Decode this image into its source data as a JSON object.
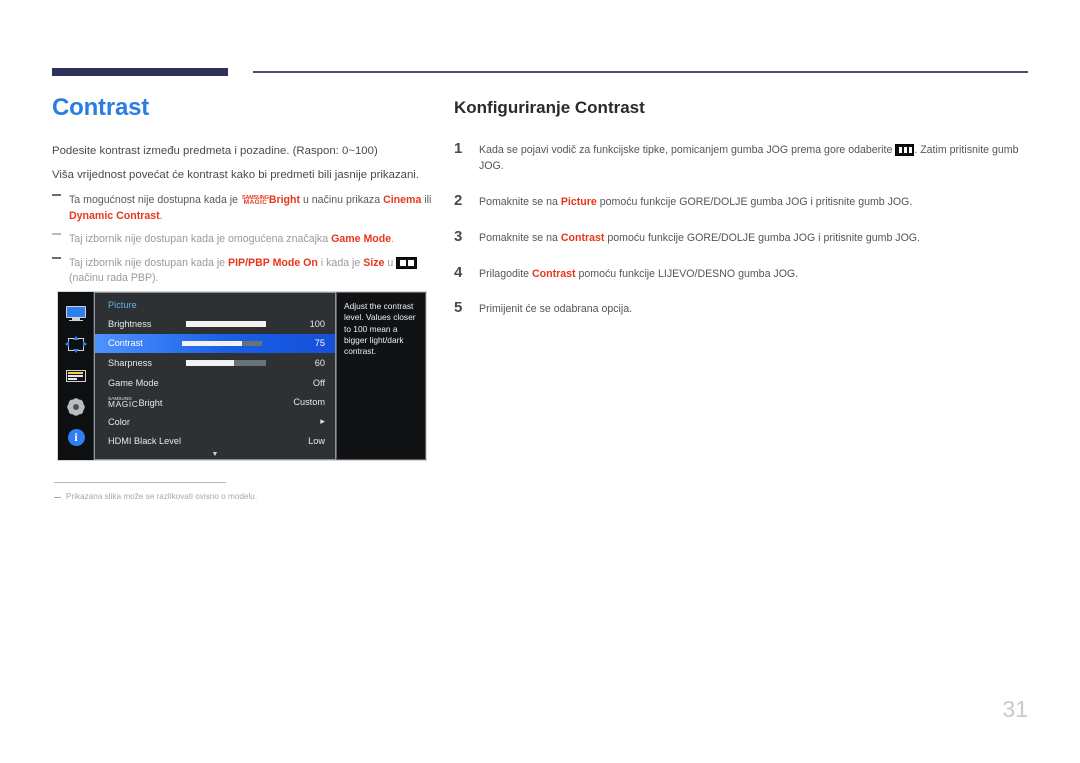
{
  "page": {
    "number": "31"
  },
  "left": {
    "title": "Contrast",
    "paragraphs": [
      "Podesite kontrast između predmeta i pozadine. (Raspon: 0~100)",
      "Viša vrijednost povećat će kontrast kako bi predmeti bili jasnije prikazani."
    ],
    "notes": [
      {
        "pre": "Ta mogućnost nije dostupna kada je ",
        "magic_top": "SAMSUNG",
        "magic_bottom": "MAGIC",
        "bold1": "Bright",
        "mid": " u načinu prikaza ",
        "bold2": "Cinema",
        "mid2": " ili ",
        "bold3": "Dynamic Contrast",
        "post": "."
      },
      {
        "pre": "Taj izbornik nije dostupan kada je omogućena značajka ",
        "bold1": "Game Mode",
        "post": "."
      },
      {
        "pre": "Taj izbornik nije dostupan kada je ",
        "bold1": "PIP/PBP Mode On",
        "mid": " i kada je ",
        "bold2": "Size",
        "mid2": " u ",
        "icon": "split-screen-icon",
        "post": " (načinu rada PBP)."
      }
    ],
    "footnote": "Prikazana slika može se razlikovati ovisno o modelu."
  },
  "osd": {
    "rail_icons": [
      "monitor-icon",
      "move-arrows-icon",
      "osd-menu-icon",
      "gear-icon",
      "info-icon"
    ],
    "info_glyph": "i",
    "menu_title": "Picture",
    "rows": [
      {
        "label": "Brightness",
        "value": "100",
        "bar": 100,
        "selected": false,
        "type": "slider"
      },
      {
        "label": "Contrast",
        "value": "75",
        "bar": 75,
        "selected": true,
        "type": "slider"
      },
      {
        "label": "Sharpness",
        "value": "60",
        "bar": 60,
        "selected": false,
        "type": "slider"
      },
      {
        "label": "Game Mode",
        "value": "Off",
        "selected": false,
        "type": "value"
      },
      {
        "label": "MAGICBright",
        "magic_top": "SAMSUNG",
        "magic_bottom": "MAGIC",
        "label_rest": "Bright",
        "value": "Custom",
        "selected": false,
        "type": "magic"
      },
      {
        "label": "Color",
        "value": "▸",
        "selected": false,
        "type": "submenu"
      },
      {
        "label": "HDMI Black Level",
        "value": "Low",
        "selected": false,
        "type": "value"
      }
    ],
    "scroll_down": "▼",
    "tooltip": "Adjust the contrast level. Values closer to 100 mean a bigger light/dark contrast."
  },
  "right": {
    "title": "Konfiguriranje Contrast",
    "steps": [
      {
        "num": "1",
        "pre": "Kada se pojavi vodič za funkcijske tipke, pomicanjem gumba JOG prema gore odaberite ",
        "icon": "menu-bars-icon",
        "post": ". Zatim pritisnite gumb JOG."
      },
      {
        "num": "2",
        "pre": "Pomaknite se na ",
        "bold": "Picture",
        "post": " pomoću funkcije GORE/DOLJE gumba JOG i pritisnite gumb JOG."
      },
      {
        "num": "3",
        "pre": "Pomaknite se na ",
        "bold": "Contrast",
        "post": " pomoću funkcije GORE/DOLJE gumba JOG i pritisnite gumb JOG."
      },
      {
        "num": "4",
        "pre": "Prilagodite ",
        "bold": "Contrast",
        "post": " pomoću funkcije LIJEVO/DESNO gumba JOG."
      },
      {
        "num": "5",
        "pre": "Primijenit će se odabrana opcija.",
        "bold": "",
        "post": ""
      }
    ]
  },
  "colors": {
    "title_blue": "#2b7de0",
    "accent_red": "#e8361c",
    "header_navy": "#2e3258",
    "osd_select_blue": "#1a5fe8"
  }
}
